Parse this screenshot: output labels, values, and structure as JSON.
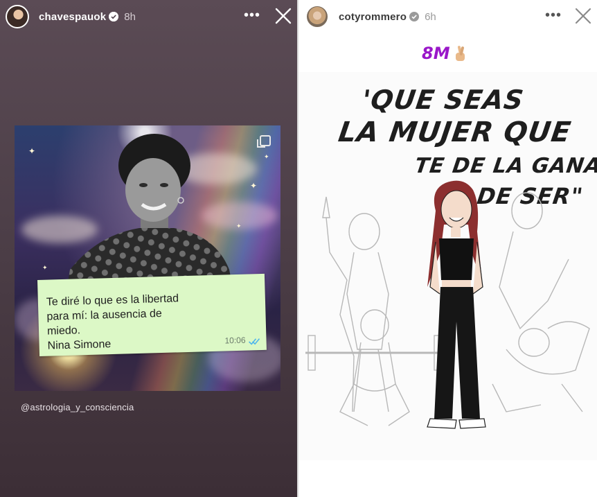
{
  "stories": [
    {
      "username": "chavespauok",
      "time": "8h",
      "more_label": "•••",
      "post": {
        "quote_lines": [
          "Te diré lo que es la libertad",
          "para mí: la ausencia de",
          "miedo.",
          "Nina Simone"
        ],
        "message_time": "10:06"
      },
      "caption": "@astrologia_y_consciencia"
    },
    {
      "username": "cotyrommero",
      "time": "6h",
      "more_label": "•••",
      "tag": "8M",
      "illustration_text": [
        "'QUE SEAS",
        "LA MUJER QUE",
        "TE DE LA GANA",
        "DE SER\""
      ]
    }
  ],
  "colors": {
    "left_background": "#4f414a",
    "chat_bubble": "#dcf8c6",
    "tag_purple": "#9a18c9",
    "verified_blue": "#3797f0",
    "read_ticks": "#4fb6ec"
  },
  "icons": {
    "verified": "verified-badge-icon",
    "more": "more-options-icon",
    "close": "close-icon",
    "carousel": "multi-image-icon",
    "read": "double-check-icon",
    "emoji": "crossed-fingers-icon"
  }
}
